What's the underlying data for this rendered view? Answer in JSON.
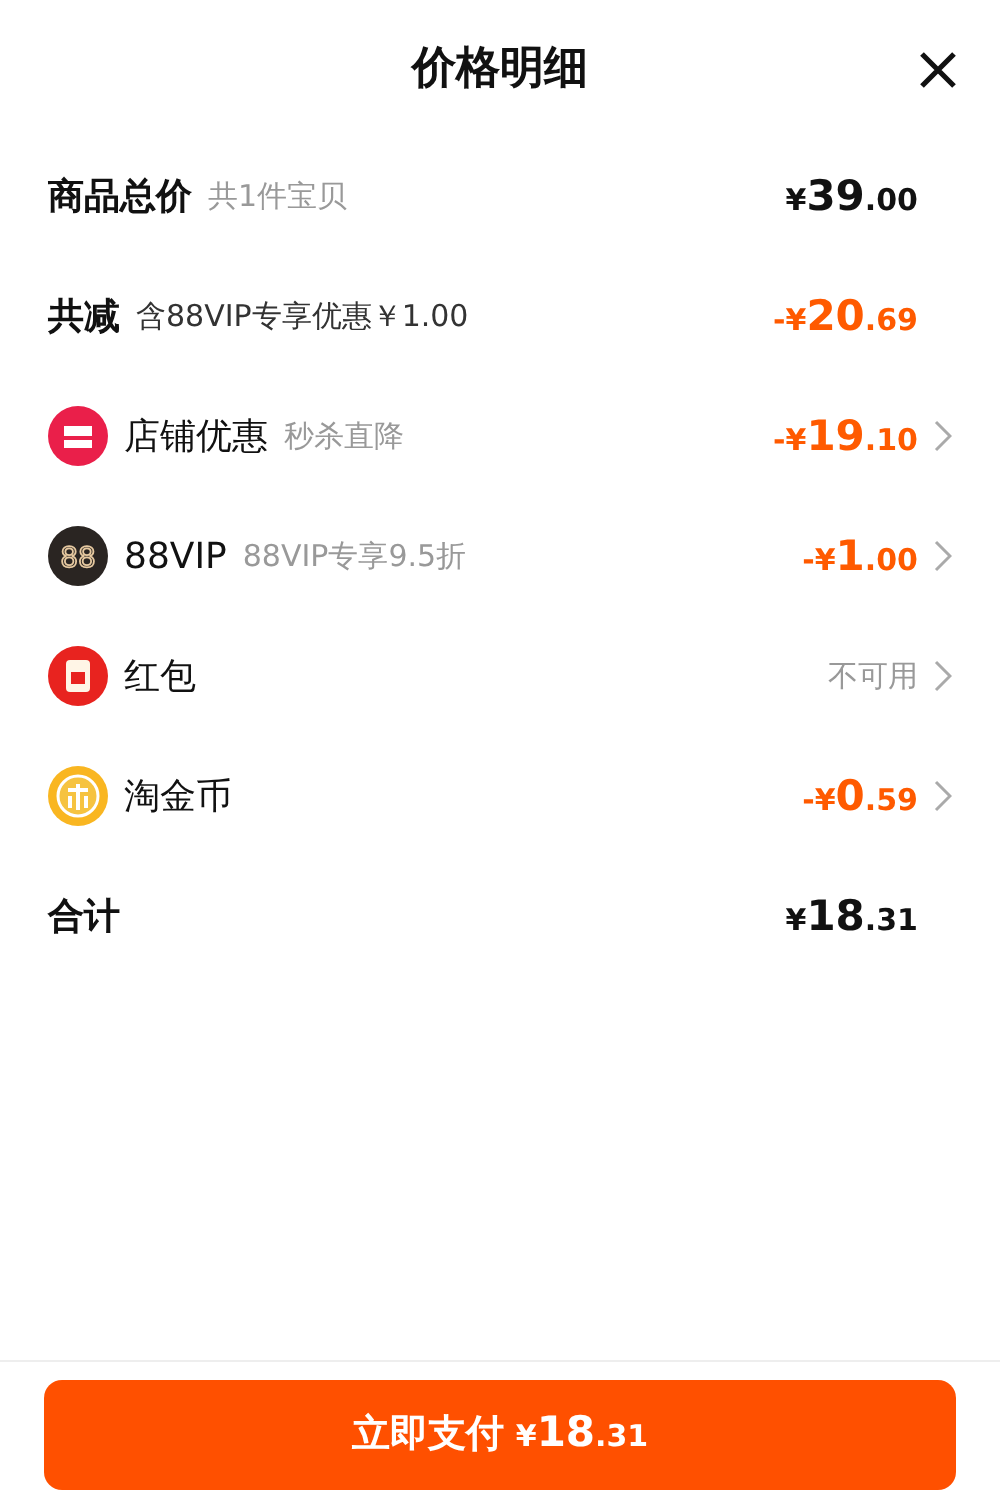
{
  "title": "价格明细",
  "rows": [
    {
      "kind": "summary",
      "label": "商品总价",
      "note": "共1件宝贝",
      "note_muted": true,
      "amount": "¥39.00",
      "highlighted": false,
      "chevron": false
    },
    {
      "kind": "summary",
      "label": "共减",
      "note": "含88VIP专享优惠￥1.00",
      "note_muted": false,
      "amount": "-¥20.69",
      "highlighted": true,
      "chevron": false
    },
    {
      "kind": "shop",
      "label": "店铺优惠",
      "note": "秒杀直降",
      "note_muted": true,
      "amount": "-¥19.10",
      "highlighted": true,
      "chevron": true
    },
    {
      "kind": "vip",
      "label": "88VIP",
      "note": "88VIP专享9.5折",
      "note_muted": true,
      "amount": "-¥1.00",
      "highlighted": true,
      "chevron": true,
      "badge": "88"
    },
    {
      "kind": "redpacket",
      "label": "红包",
      "amount": "不可用",
      "disabled": true,
      "chevron": true
    },
    {
      "kind": "coin",
      "label": "淘金币",
      "amount": "-¥0.59",
      "highlighted": true,
      "chevron": true
    },
    {
      "kind": "summary",
      "label": "合计",
      "amount": "¥18.31",
      "highlighted": false,
      "chevron": false
    }
  ],
  "pay_button": {
    "label": "立即支付",
    "amount": "¥18.31"
  }
}
